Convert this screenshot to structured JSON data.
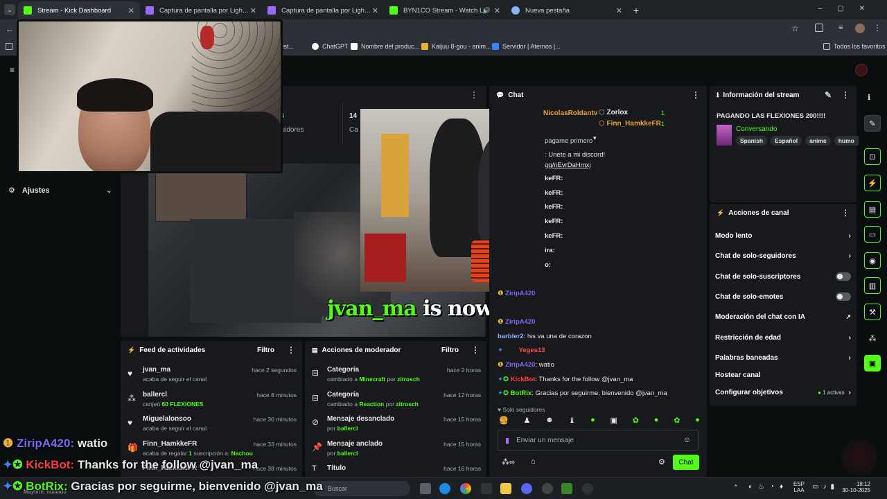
{
  "browser": {
    "tabs": [
      {
        "label": "Stream - Kick Dashboard",
        "active": true,
        "color": "#53fc18"
      },
      {
        "label": "Captura de pantalla por Lightsh",
        "active": false,
        "color": "#9b6bff"
      },
      {
        "label": "Captura de pantalla por Lightsh",
        "active": false,
        "color": "#9b6bff"
      },
      {
        "label": "BYN1CO Stream - Watch Li",
        "active": false,
        "color": "#53fc18"
      },
      {
        "label": "Nueva pestaña",
        "active": false,
        "color": "#8ab4f8"
      }
    ],
    "bookmarks": [
      "Rest...",
      "ChatGPT",
      "Nombre del produc...",
      "Kaijuu 8-gou - anim...",
      "Servidor | Aternos |..."
    ],
    "all_bookmarks": "Todos los favoritos"
  },
  "sidebar": {
    "settings_label": "Ajustes"
  },
  "stats": {
    "v1": "4",
    "l1": "guidores",
    "v2": "14",
    "l2": "Ca"
  },
  "stream_overlay": {
    "follow_user": "jvan_ma",
    "follow_text": "is now following!"
  },
  "activity": {
    "title": "Feed de actividades",
    "filter": "Filtro",
    "items": [
      {
        "user": "jvan_ma",
        "desc": "acaba de seguir el canal",
        "time": "hace 2 segundos",
        "highlight": ""
      },
      {
        "user": "ballercl",
        "desc": "canjeó",
        "highlight": "60 FLEXIONES",
        "time": "hace 8 minutos"
      },
      {
        "user": "Miguelalonsoo",
        "desc": "acaba de seguir el canal",
        "time": "hace 30 minutos",
        "highlight": ""
      },
      {
        "user": "Finn_HamkkeFR",
        "desc": "acaba de regalar",
        "highlight": "1",
        "desc2": "suscripción a:",
        "target": "Nachou",
        "time": "hace 33 minutos"
      },
      {
        "user": "Finn_HamkkeFR",
        "desc": "",
        "time": "hace 38 minutos",
        "highlight": ""
      }
    ]
  },
  "modactions": {
    "title": "Acciones de moderador",
    "filter": "Filtro",
    "items": [
      {
        "title": "Categoría",
        "pre": "cambiado a",
        "value": "Minecraft",
        "by": "por",
        "user": "zitrosch",
        "time": "hace 2 horas"
      },
      {
        "title": "Categoría",
        "pre": "cambiado a",
        "value": "Reaction",
        "by": "por",
        "user": "zitrosch",
        "time": "hace 12 horas"
      },
      {
        "title": "Mensaje desanclado",
        "pre": "",
        "value": "",
        "by": "por",
        "user": "ballercl",
        "time": "hace 15 horas"
      },
      {
        "title": "Mensaje anclado",
        "pre": "",
        "value": "",
        "by": "por",
        "user": "ballercl",
        "time": "hace 15 horas"
      },
      {
        "title": "Título",
        "pre": "",
        "value": "",
        "by": "",
        "user": "",
        "time": "hace 16 horas"
      }
    ]
  },
  "chat": {
    "title": "Chat",
    "top_users": [
      {
        "name": "NicolasRoldantv",
        "count": ""
      },
      {
        "name": "Zorlox",
        "count": "1"
      },
      {
        "name": "Finn_HamkkeFR",
        "count": "1"
      }
    ],
    "partial_lines": [
      "pagame primero",
      ": Unete a mi discord!",
      "gg/nEvrDaHmxj",
      "keFR:",
      "keFR:",
      "keFR:",
      "keFR:",
      "keFR:",
      "ira:",
      "o:"
    ],
    "messages": [
      {
        "user": "ZiripA420",
        "text": "",
        "color": "#7b68ee"
      },
      {
        "user": "ZiripA420",
        "text": "",
        "color": "#7b68ee"
      },
      {
        "user": "barbler2",
        "text": "!ss va una de corazon",
        "color": "#8ab4f8"
      },
      {
        "user": "Yeges13",
        "text": "",
        "color": "#ff4d4d"
      },
      {
        "user": "ZiripA420",
        "text": "watio",
        "color": "#7b68ee"
      },
      {
        "user": "KickBot",
        "text": "Thanks for the follow @jvan_ma",
        "color": "#ff3b3b"
      },
      {
        "user": "BotRix",
        "text": "Gracias por seguirme, bienvenido @jvan_ma",
        "color": "#53fc18"
      }
    ],
    "followers_only": "Solo seguidores",
    "placeholder": "Enviar un mensaje",
    "send_label": "Chat"
  },
  "stream_info": {
    "title": "Información del stream",
    "stream_title": "PAGANDO LAS FLEXIONES 200!!!!",
    "category": "Conversando",
    "tags": [
      "Spanish",
      "Español",
      "anime",
      "humo"
    ]
  },
  "channel_actions": {
    "title": "Acciones de canal",
    "items": [
      {
        "label": "Modo lento",
        "control": "arrow"
      },
      {
        "label": "Chat de solo-seguidores",
        "control": "arrow"
      },
      {
        "label": "Chat de solo-suscriptores",
        "control": "toggle"
      },
      {
        "label": "Chat de solo-emotes",
        "control": "toggle"
      },
      {
        "label": "Moderación del chat con IA",
        "control": "external"
      },
      {
        "label": "Restricción de edad",
        "control": "arrow"
      },
      {
        "label": "Palabras baneadas",
        "control": "arrow"
      },
      {
        "label": "Hostear canal",
        "control": "none"
      },
      {
        "label": "Configurar objetivos",
        "control": "arrow",
        "badge": "1 activas"
      }
    ]
  },
  "bottom_overlay": [
    {
      "user": "ZiripA420:",
      "text": "watio",
      "color": "#7b68ee"
    },
    {
      "user": "KickBot:",
      "text": "Thanks for the follow @jvan_ma",
      "color": "#ff3b3b"
    },
    {
      "user": "BotRix:",
      "text": "Gracias por seguirme, bienvenido @jvan_ma",
      "color": "#53fc18"
    }
  ],
  "taskbar": {
    "search_placeholder": "Buscar",
    "weather": "Mayorm. nublado",
    "lang": "ESP",
    "lang2": "LAA",
    "time": "18:12",
    "date": "30-10-2025"
  },
  "colors": {
    "accent": "#53fc18",
    "panel": "#17191c",
    "bg": "#0b0e0f"
  }
}
